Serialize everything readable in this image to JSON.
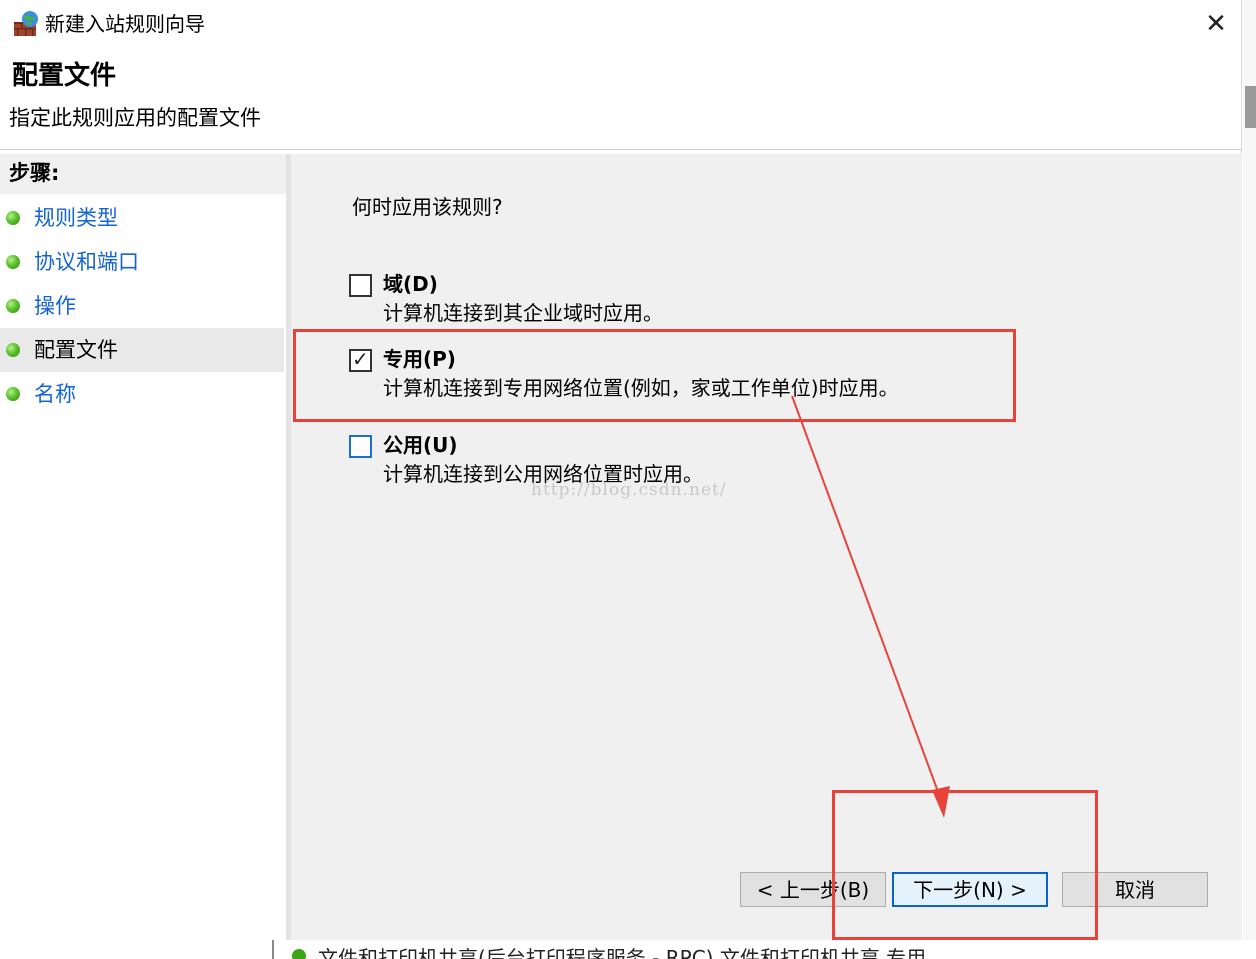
{
  "window": {
    "title": "新建入站规则向导",
    "close_glyph": "✕"
  },
  "header": {
    "title": "配置文件",
    "subtitle": "指定此规则应用的配置文件"
  },
  "steps": {
    "title": "步骤:",
    "items": [
      {
        "label": "规则类型"
      },
      {
        "label": "协议和端口"
      },
      {
        "label": "操作"
      },
      {
        "label": "配置文件"
      },
      {
        "label": "名称"
      }
    ],
    "active_index": 3
  },
  "main": {
    "question": "何时应用该规则?",
    "options": [
      {
        "label": "域(D)",
        "description": "计算机连接到其企业域时应用。",
        "checked": false
      },
      {
        "label": "专用(P)",
        "description": "计算机连接到专用网络位置(例如，家或工作单位)时应用。",
        "checked": true
      },
      {
        "label": "公用(U)",
        "description": "计算机连接到公用网络位置时应用。",
        "checked": false
      }
    ],
    "watermark": "http://blog.csdn.net/"
  },
  "buttons": {
    "back": "< 上一步(B)",
    "next": "下一步(N) >",
    "cancel": "取消"
  },
  "background_row": {
    "text": "文件和打印机共享(后台打印程序服务 - RPC)        文件和打印机共享            专用"
  },
  "colors": {
    "annotation": "#e8433a",
    "link": "#1464d4",
    "step_bullet": "#5cc12d",
    "primary_border": "#0a64c8"
  },
  "icons": {
    "app": "firewall-icon",
    "close": "close-icon",
    "bullet": "green-dot-icon",
    "check": "checkmark-icon"
  }
}
